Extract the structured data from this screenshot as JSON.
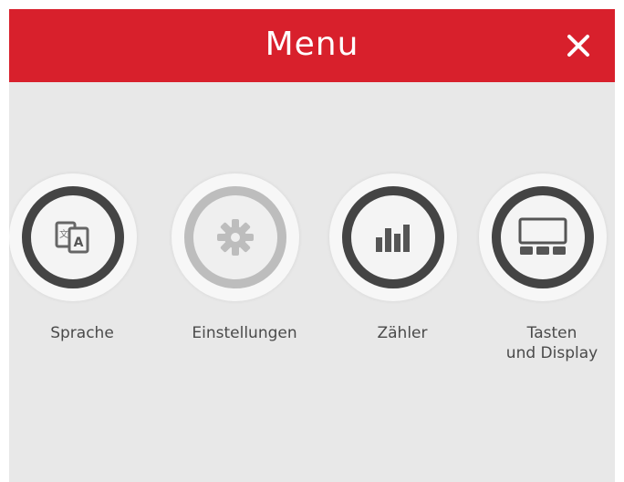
{
  "header": {
    "title": "Menu",
    "close_icon": "close-icon",
    "background_color": "#d8202c"
  },
  "menu_items": [
    {
      "label_line1": "Sprache",
      "label_line2": "",
      "icon": "language-icon",
      "enabled": true
    },
    {
      "label_line1": "Einstellungen",
      "label_line2": "",
      "icon": "gear-icon",
      "enabled": false
    },
    {
      "label_line1": "Zähler",
      "label_line2": "",
      "icon": "bar-chart-icon",
      "enabled": true
    },
    {
      "label_line1": "Tasten",
      "label_line2": "und Display",
      "icon": "display-keys-icon",
      "enabled": true
    }
  ],
  "colors": {
    "background": "#e8e8e8",
    "ring_active": "#444444",
    "ring_disabled": "#bdbdbd",
    "label_text": "#4a4a4a"
  }
}
